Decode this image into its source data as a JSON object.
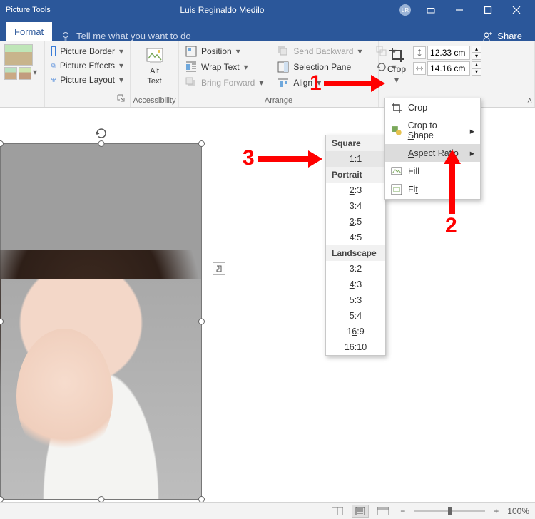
{
  "title": {
    "contextual": "Picture Tools",
    "document": "Luis Reginaldo Medilo",
    "initials": "LR"
  },
  "tabs": {
    "format": "Format",
    "tellme": "Tell me what you want to do",
    "share": "Share"
  },
  "ribbon": {
    "accessibility": {
      "alt_text_line1": "Alt",
      "alt_text_line2": "Text",
      "group_label": "Accessibility"
    },
    "picture_styles": {
      "border": "Picture Border",
      "effects": "Picture Effects",
      "layout": "Picture Layout"
    },
    "arrange": {
      "group_label": "Arrange",
      "position": "Position",
      "wrap_text": "Wrap Text",
      "bring_forward": "Bring Forward",
      "send_backward": "Send Backward",
      "selection_pane": "Selection Pane",
      "align": "Align"
    },
    "size": {
      "crop_label": "Crop",
      "height_value": "12.33 cm",
      "width_value": "14.16 cm"
    }
  },
  "crop_menu": {
    "crop": "Crop",
    "crop_to_shape": "Crop to Shape",
    "aspect_ratio": "Aspect Ratio",
    "fill": "Fill",
    "fit": "Fit"
  },
  "aspect_ratio_menu": {
    "square_header": "Square",
    "square": [
      "1:1"
    ],
    "portrait_header": "Portrait",
    "portrait": [
      "2:3",
      "3:4",
      "3:5",
      "4:5"
    ],
    "landscape_header": "Landscape",
    "landscape": [
      "3:2",
      "4:3",
      "5:3",
      "5:4",
      "16:9",
      "16:10"
    ]
  },
  "annotations": {
    "n1": "1",
    "n2": "2",
    "n3": "3"
  },
  "statusbar": {
    "zoom_pct": "100%"
  }
}
